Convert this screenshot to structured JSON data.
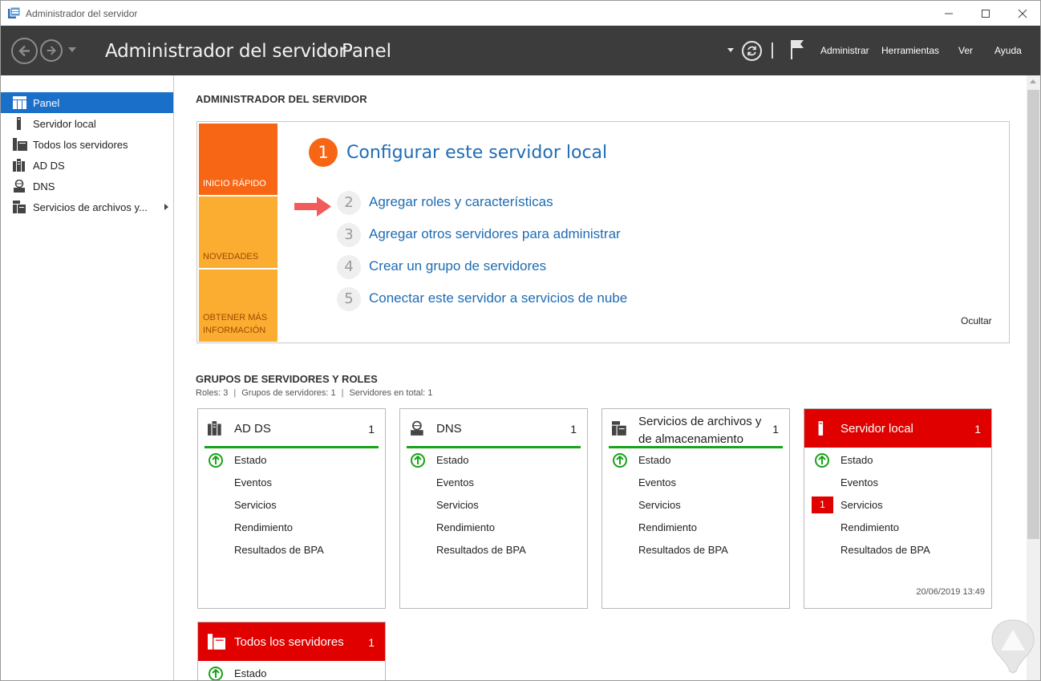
{
  "window": {
    "title": "Administrador del servidor",
    "controls": [
      "minimize",
      "maximize",
      "close"
    ]
  },
  "header": {
    "breadcrumb_root": "Administrador del servidor",
    "breadcrumb_page": "Panel",
    "menu": [
      "Administrar",
      "Herramientas",
      "Ver",
      "Ayuda"
    ]
  },
  "sidebar": {
    "items": [
      {
        "label": "Panel",
        "icon": "dashboard-icon",
        "active": true
      },
      {
        "label": "Servidor local",
        "icon": "server-icon"
      },
      {
        "label": "Todos los servidores",
        "icon": "servers-icon"
      },
      {
        "label": "AD DS",
        "icon": "ad-ds-icon"
      },
      {
        "label": "DNS",
        "icon": "dns-icon"
      },
      {
        "label": "Servicios de archivos y...",
        "icon": "file-services-icon",
        "has_submenu": true
      }
    ]
  },
  "main": {
    "section_title": "ADMINISTRADOR DEL SERVIDOR",
    "quick_start": {
      "tiles": [
        "INICIO RÁPIDO",
        "NOVEDADES",
        "OBTENER MÁS INFORMACIÓN"
      ],
      "steps": [
        {
          "number": "1",
          "text": "Configurar este servidor local"
        },
        {
          "number": "2",
          "text": "Agregar roles y características"
        },
        {
          "number": "3",
          "text": "Agregar otros servidores para administrar"
        },
        {
          "number": "4",
          "text": "Crear un grupo de servidores"
        },
        {
          "number": "5",
          "text": "Conectar este servidor a servicios de nube"
        }
      ],
      "hide_label": "Ocultar"
    },
    "groups": {
      "title": "GRUPOS DE SERVIDORES Y ROLES",
      "summary": [
        "Roles: 3",
        "Grupos de servidores: 1",
        "Servidores en total: 1"
      ],
      "cards": [
        {
          "title": "AD DS",
          "count": "1",
          "status": "ok",
          "rows": [
            "Estado",
            "Eventos",
            "Servicios",
            "Rendimiento",
            "Resultados de BPA"
          ]
        },
        {
          "title": "DNS",
          "count": "1",
          "status": "ok",
          "rows": [
            "Estado",
            "Eventos",
            "Servicios",
            "Rendimiento",
            "Resultados de BPA"
          ]
        },
        {
          "title_line1": "Servicios de archivos y",
          "title_line2": "de almacenamiento",
          "count": "1",
          "status": "ok",
          "rows": [
            "Estado",
            "Eventos",
            "Servicios",
            "Rendimiento",
            "Resultados de BPA"
          ]
        },
        {
          "title": "Servidor local",
          "count": "1",
          "status": "alert",
          "rows": [
            "Estado",
            "Eventos",
            "Servicios",
            "Rendimiento",
            "Resultados de BPA"
          ],
          "services_alert_count": "1",
          "timestamp": "20/06/2019 13:49"
        },
        {
          "title": "Todos los servidores",
          "count": "1",
          "status": "alert",
          "rows": [
            "Estado"
          ]
        }
      ]
    }
  },
  "colors": {
    "header_bg": "#3c3c3c",
    "sidebar_active": "#1a6fc9",
    "quick_start_orange": "#f76614",
    "tile_yellow": "#fbad31",
    "link_blue": "#1e6cb4",
    "ok_green": "#18a318",
    "alert_red": "#e00000"
  }
}
